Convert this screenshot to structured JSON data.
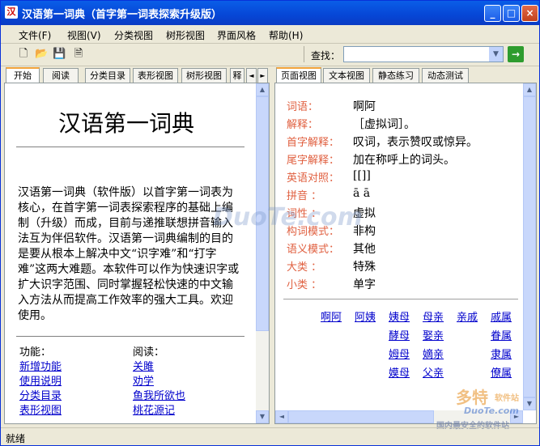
{
  "window": {
    "title": "汉语第一词典（首字第一词表探索升级版）",
    "icon_text": "汉",
    "min": "_",
    "max": "□",
    "close": "×"
  },
  "menu": [
    "文件(F)",
    "视图(V)",
    "分类视图",
    "树形视图",
    "界面风格",
    "帮助(H)"
  ],
  "toolbar": {
    "icons": [
      "new-file-icon",
      "open-folder-icon",
      "save-disk-icon",
      "print-preview-icon"
    ],
    "find_label": "查找：",
    "find_value": "",
    "go": "→"
  },
  "left_tabs": [
    "开始",
    "阅读",
    "分类目录",
    "表形视图",
    "树形视图",
    "释"
  ],
  "left": {
    "title": "汉语第一词典",
    "paragraph": "汉语第一词典（软件版）以首字第一词表为核心，在首字第一词表探索程序的基础上编制（升级）而成，目前与递推联想拼音输入法互为伴侣软件。汉语第一词典编制的目的是要从根本上解决中文“识字难”和“打字难”这两大难题。本软件可以作为快速识字或扩大识字范围、同时掌握轻松快速的中文输入方法从而提高工作效率的强大工具。欢迎使用。",
    "func_head": "功能：",
    "func_links": [
      "新增功能",
      "使用说明",
      "分类目录",
      "表形视图"
    ],
    "read_head": "阅读：",
    "read_links": [
      "关雎",
      "劝学",
      "鱼我所欲也",
      "桃花源记"
    ]
  },
  "right_tabs": [
    "页面视图",
    "文本视图",
    "静态练习",
    "动态测试"
  ],
  "right": {
    "fields": [
      {
        "label": "词语：",
        "value": "啊阿"
      },
      {
        "label": "解释：",
        "value": "［虚拟词］。"
      },
      {
        "label": "首字解释：",
        "value": "叹词，表示赞叹或惊异。"
      },
      {
        "label": "尾字解释：",
        "value": "加在称呼上的词头。"
      },
      {
        "label": "英语对照：",
        "value": "[[]]"
      },
      {
        "label": "拼音 ：",
        "value": "ā ā"
      },
      {
        "label": "词性 ：",
        "value": "虚拟"
      },
      {
        "label": "构词模式：",
        "value": "非构"
      },
      {
        "label": "语义模式：",
        "value": "其他"
      },
      {
        "label": "大类 ：",
        "value": "特殊"
      },
      {
        "label": "小类 ：",
        "value": "单字"
      }
    ],
    "related": {
      "row1": [
        "啊阿",
        "阿姨",
        "姨母",
        "母亲",
        "亲戚",
        "戚属"
      ],
      "row2": [
        "酵母",
        "娶亲",
        "眷属"
      ],
      "row3": [
        "姆母",
        "嫡亲",
        "隶属"
      ],
      "row4": [
        "嫫母",
        "父亲",
        "僚属"
      ]
    }
  },
  "status": "就绪",
  "watermark": {
    "main": "DuoTe.com",
    "brand": "多特",
    "sub": "软件站",
    "site": "DuoTe.com",
    "tagline": "国内最安全的软件站"
  }
}
